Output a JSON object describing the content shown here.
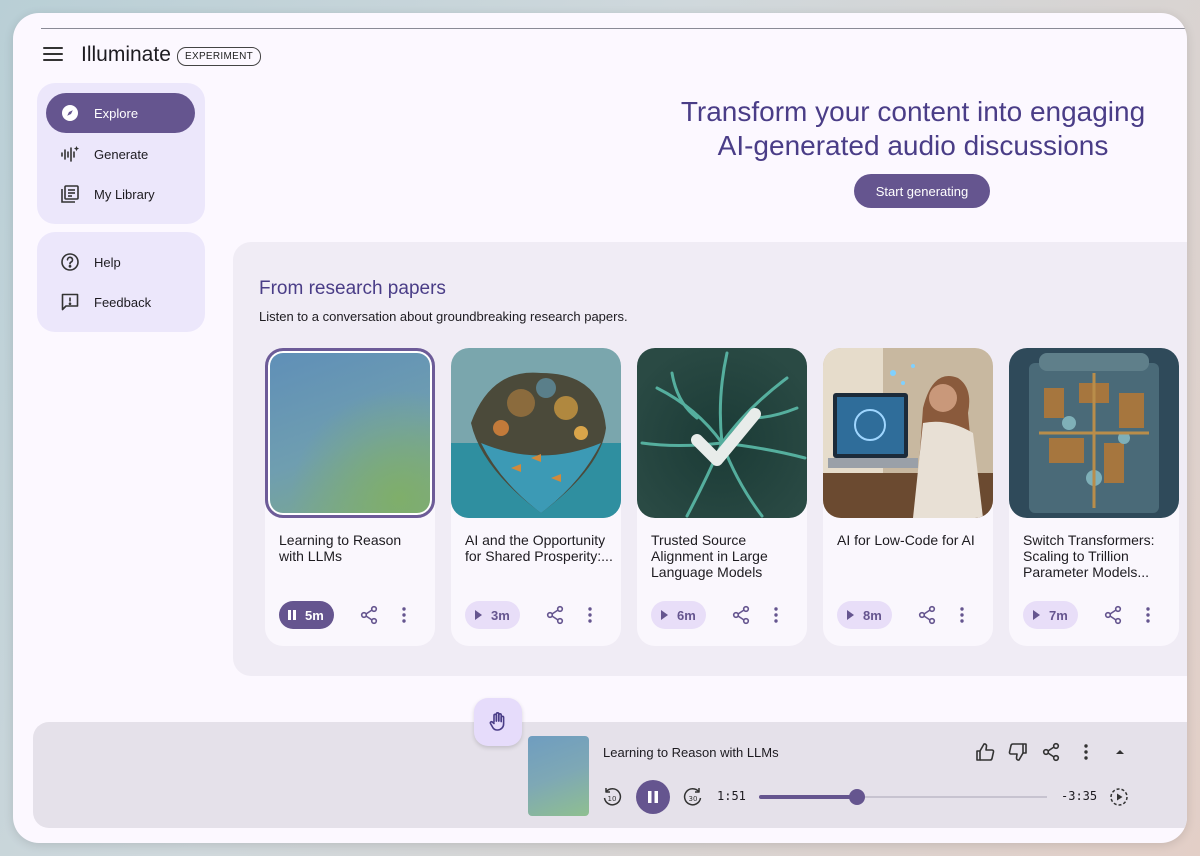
{
  "app": {
    "title": "Illuminate",
    "badge": "EXPERIMENT"
  },
  "sidebar": {
    "items": [
      {
        "label": "Explore",
        "icon": "compass-icon",
        "active": true
      },
      {
        "label": "Generate",
        "icon": "sparkle-waveform-icon",
        "active": false
      },
      {
        "label": "My Library",
        "icon": "library-icon",
        "active": false
      }
    ],
    "secondary": [
      {
        "label": "Help",
        "icon": "help-icon"
      },
      {
        "label": "Feedback",
        "icon": "feedback-icon"
      }
    ]
  },
  "hero": {
    "line1": "Transform your content into engaging",
    "line2": "AI-generated audio discussions",
    "cta": "Start generating"
  },
  "section": {
    "title": "From research papers",
    "subtitle": "Listen to a conversation about groundbreaking research papers.",
    "cards": [
      {
        "title": "Learning to Reason with LLMs",
        "duration": "5m",
        "playing": true,
        "selected": true
      },
      {
        "title": "AI and the Opportunity for Shared Prosperity:...",
        "duration": "3m",
        "playing": false
      },
      {
        "title": "Trusted Source Alignment in Large Language Models",
        "duration": "6m",
        "playing": false
      },
      {
        "title": "AI for Low-Code for AI",
        "duration": "8m",
        "playing": false
      },
      {
        "title": "Switch Transformers: Scaling to Trillion Parameter Models...",
        "duration": "7m",
        "playing": false
      }
    ]
  },
  "player": {
    "title": "Learning to Reason with LLMs",
    "elapsed": "1:51",
    "remaining": "-3:35",
    "progress": 0.34,
    "skip_back_seconds": "10",
    "skip_forward_seconds": "30"
  },
  "colors": {
    "accent": "#65558f",
    "accent_light": "#e8def8",
    "heading": "#4a3d87",
    "surface": "#fcf8ff"
  }
}
